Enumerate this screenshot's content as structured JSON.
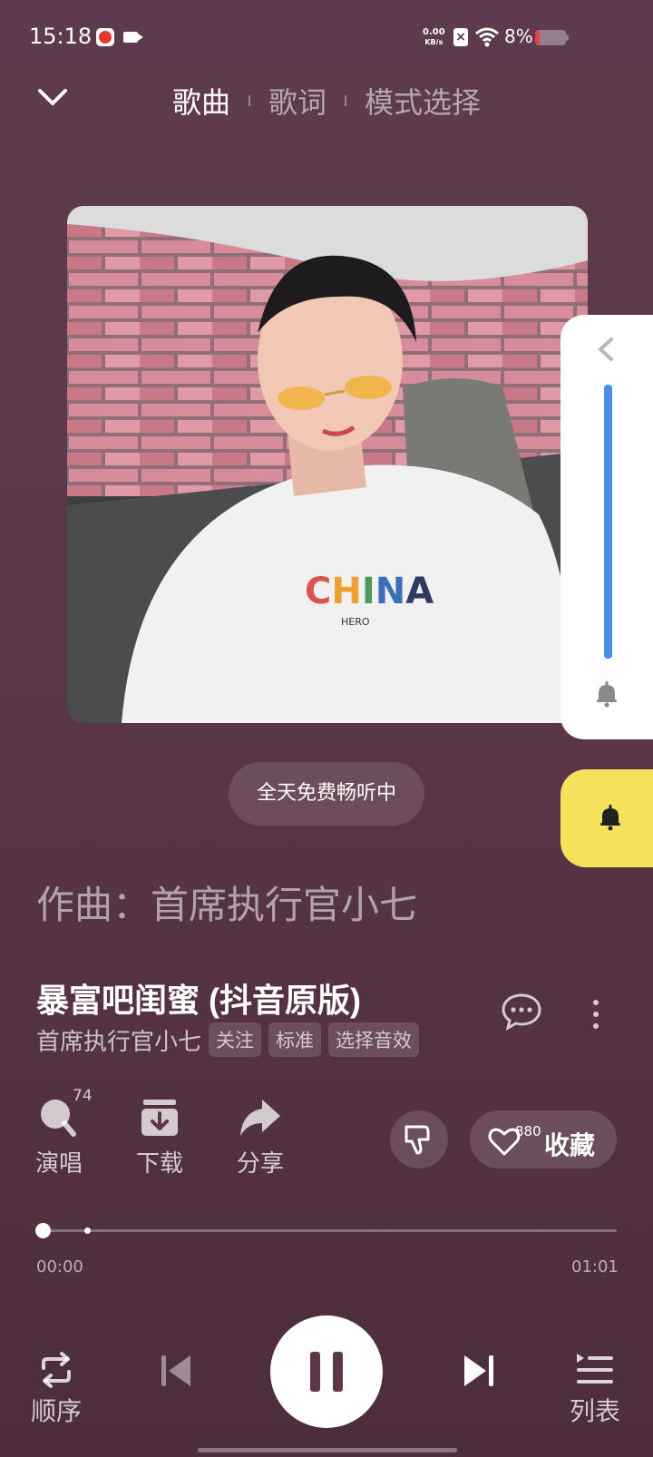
{
  "status_bar": {
    "time": "15:18",
    "net_speed_top": "0.00",
    "net_speed_unit": "KB/s",
    "battery": "8%",
    "battery_level": 0.08
  },
  "tabs": [
    {
      "label": "歌曲",
      "active": true
    },
    {
      "label": "歌词",
      "active": false
    },
    {
      "label": "模式选择",
      "active": false
    }
  ],
  "banner": "全天免费畅听中",
  "lyric_line": "作曲：首席执行官小七",
  "song": {
    "title": "暴富吧闺蜜 (抖音原版)",
    "artist": "首席执行官小七",
    "tags": [
      "关注",
      "标准",
      "选择音效"
    ]
  },
  "actions": {
    "sing": {
      "label": "演唱",
      "count": "74"
    },
    "download": {
      "label": "下载"
    },
    "share": {
      "label": "分享"
    },
    "collect": {
      "label": "收藏",
      "count": "880"
    }
  },
  "progress": {
    "current": "00:00",
    "total": "01:01",
    "fraction": 0.0
  },
  "controls": {
    "mode": "顺序",
    "list": "列表"
  },
  "colors": {
    "background": "#5b3749",
    "volume_bar": "#4a8ee8",
    "bell_button": "#f6e25a"
  },
  "album_art": "photo of a young man with orange sunglasses wearing a white CHINA sweatshirt in a car",
  "album_art_text": {
    "shirt_brand": "CHINA",
    "shirt_sub": "HERO"
  }
}
